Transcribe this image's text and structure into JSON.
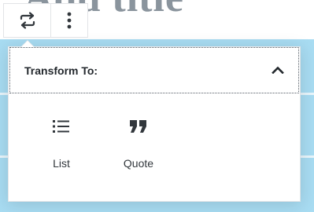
{
  "background": {
    "title_text": "Add title",
    "highlight_color": "#a8dcf2"
  },
  "toolbar": {
    "transform_button_icon": "transform-arrows-icon",
    "more_options_icon": "vertical-ellipsis-icon"
  },
  "transform_panel": {
    "title": "Transform To:",
    "toggle_icon": "chevron-up-icon",
    "items": [
      {
        "label": "List",
        "icon": "list-icon"
      },
      {
        "label": "Quote",
        "icon": "quote-icon"
      }
    ]
  }
}
